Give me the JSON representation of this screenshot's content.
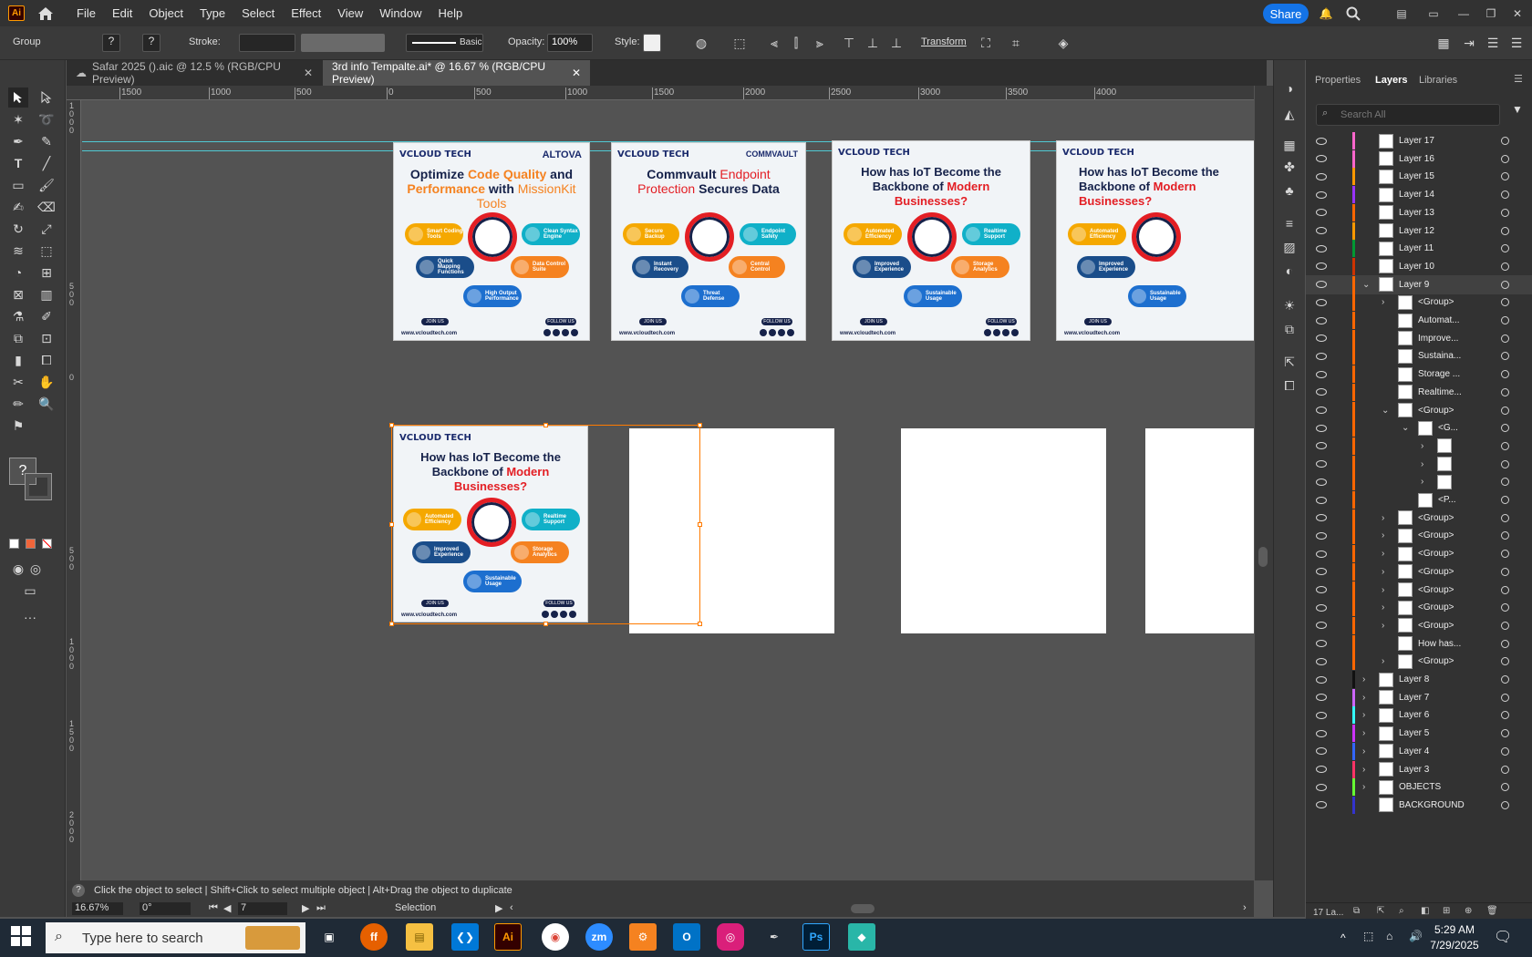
{
  "app": {
    "logo": "Ai"
  },
  "menu": [
    "File",
    "Edit",
    "Object",
    "Type",
    "Select",
    "Effect",
    "View",
    "Window",
    "Help"
  ],
  "header": {
    "share_label": "Share"
  },
  "control": {
    "selection_type": "Group",
    "stroke_label": "Stroke:",
    "stroke_style": "Basic",
    "opacity_label": "Opacity:",
    "opacity_value": "100%",
    "style_label": "Style:",
    "transform_label": "Transform",
    "q1": "?",
    "q2": "?"
  },
  "tabs": [
    {
      "label": "Safar 2025 ().aic @ 12.5 % (RGB/CPU Preview)"
    },
    {
      "label": "3rd info Tempalte.ai* @ 16.67 % (RGB/CPU Preview)"
    }
  ],
  "ruler": {
    "h": [
      "1500",
      "1000",
      "500",
      "0",
      "500",
      "1000",
      "1500",
      "2000",
      "2500",
      "3000",
      "3500",
      "4000"
    ],
    "v": [
      "1\n0\n0\n0",
      "5\n0\n0",
      "0",
      "5\n0\n0",
      "1\n0\n0\n0",
      "1\n5\n0\n0",
      "2\n0\n0\n0"
    ]
  },
  "artboards": {
    "a1": {
      "brand": "VCLOUD TECH",
      "partner": "ALTOVA",
      "headline_1": "Optimize ",
      "headline_2": "Code Quality",
      "headline_3": " and ",
      "headline_4": "Performance",
      "headline_5": " with ",
      "headline_6": "MissionKit Tools",
      "f1": "Smart Coding Tools",
      "f2": "Clean Syntax Engine",
      "f3": "Quick Mapping Functions",
      "f4": "Data Control Suite",
      "f5": "High Output Performance"
    },
    "a2": {
      "brand": "VCLOUD TECH",
      "partner": "COMMVAULT",
      "headline_1": "Commvault ",
      "headline_2": "Endpoint Protection",
      "headline_3": " Secures Data",
      "f1": "Secure Backup",
      "f2": "Endpoint Safety",
      "f3": "Instant Recovery",
      "f4": "Central Control",
      "f5": "Threat Defense"
    },
    "a3": {
      "brand": "VCLOUD TECH",
      "headline_1": "How has IoT Become the Backbone of ",
      "headline_2": "Modern Businesses?",
      "f1": "Automated Efficiency",
      "f2": "Realtime Support",
      "f3": "Improved Experience",
      "f4": "Storage Analytics",
      "f5": "Sustainable Usage"
    },
    "join": "JOIN US",
    "follow": "FOLLOW US",
    "site": "www.vcloudtech.com"
  },
  "hint": {
    "text": "Click the object to select  |  Shift+Click to select multiple object  |  Alt+Drag the object to duplicate"
  },
  "status": {
    "zoom": "16.67%",
    "rotation": "0°",
    "artboard": "7",
    "tool": "Selection"
  },
  "panel": {
    "tabs": [
      "Properties",
      "Layers",
      "Libraries"
    ],
    "search_placeholder": "Search All",
    "footer": "17 La..."
  },
  "layers": [
    {
      "name": "Layer 17",
      "color": "#ff66cc",
      "indent": 0,
      "chev": ""
    },
    {
      "name": "Layer 16",
      "color": "#ff66cc",
      "indent": 0,
      "chev": ""
    },
    {
      "name": "Layer 15",
      "color": "#ff9900",
      "indent": 0,
      "chev": ""
    },
    {
      "name": "Layer 14",
      "color": "#9933ff",
      "indent": 0,
      "chev": ""
    },
    {
      "name": "Layer 13",
      "color": "#ff6600",
      "indent": 0,
      "chev": ""
    },
    {
      "name": "Layer 12",
      "color": "#ff9900",
      "indent": 0,
      "chev": ""
    },
    {
      "name": "Layer 11",
      "color": "#009933",
      "indent": 0,
      "chev": ""
    },
    {
      "name": "Layer 10",
      "color": "#cc3300",
      "indent": 0,
      "chev": ""
    },
    {
      "name": "Layer 9",
      "color": "#ff6600",
      "indent": 0,
      "chev": "v",
      "sel": true
    },
    {
      "name": "<Group>",
      "color": "#ff6600",
      "indent": 1,
      "chev": ">"
    },
    {
      "name": "Automat...",
      "color": "#ff6600",
      "indent": 1,
      "chev": ""
    },
    {
      "name": "Improve...",
      "color": "#ff6600",
      "indent": 1,
      "chev": ""
    },
    {
      "name": "Sustaina...",
      "color": "#ff6600",
      "indent": 1,
      "chev": ""
    },
    {
      "name": "Storage ...",
      "color": "#ff6600",
      "indent": 1,
      "chev": ""
    },
    {
      "name": "Realtime...",
      "color": "#ff6600",
      "indent": 1,
      "chev": ""
    },
    {
      "name": "<Group>",
      "color": "#ff6600",
      "indent": 1,
      "chev": "v"
    },
    {
      "name": "<G...",
      "color": "#ff6600",
      "indent": 2,
      "chev": "v"
    },
    {
      "name": "",
      "color": "#ff6600",
      "indent": 3,
      "chev": ">"
    },
    {
      "name": "",
      "color": "#ff6600",
      "indent": 3,
      "chev": ">"
    },
    {
      "name": "",
      "color": "#ff6600",
      "indent": 3,
      "chev": ">"
    },
    {
      "name": "<P...",
      "color": "#ff6600",
      "indent": 2,
      "chev": ""
    },
    {
      "name": "<Group>",
      "color": "#ff6600",
      "indent": 1,
      "chev": ">"
    },
    {
      "name": "<Group>",
      "color": "#ff6600",
      "indent": 1,
      "chev": ">"
    },
    {
      "name": "<Group>",
      "color": "#ff6600",
      "indent": 1,
      "chev": ">"
    },
    {
      "name": "<Group>",
      "color": "#ff6600",
      "indent": 1,
      "chev": ">"
    },
    {
      "name": "<Group>",
      "color": "#ff6600",
      "indent": 1,
      "chev": ">"
    },
    {
      "name": "<Group>",
      "color": "#ff6600",
      "indent": 1,
      "chev": ">"
    },
    {
      "name": "<Group>",
      "color": "#ff6600",
      "indent": 1,
      "chev": ">"
    },
    {
      "name": "How has...",
      "color": "#ff6600",
      "indent": 1,
      "chev": ""
    },
    {
      "name": "<Group>",
      "color": "#ff6600",
      "indent": 1,
      "chev": ">"
    },
    {
      "name": "Layer 8",
      "color": "#111111",
      "indent": 0,
      "chev": ">"
    },
    {
      "name": "Layer 7",
      "color": "#cc66ff",
      "indent": 0,
      "chev": ">"
    },
    {
      "name": "Layer 6",
      "color": "#33ffff",
      "indent": 0,
      "chev": ">"
    },
    {
      "name": "Layer 5",
      "color": "#cc33ff",
      "indent": 0,
      "chev": ">"
    },
    {
      "name": "Layer 4",
      "color": "#3366ff",
      "indent": 0,
      "chev": ">"
    },
    {
      "name": "Layer 3",
      "color": "#ff3366",
      "indent": 0,
      "chev": ">"
    },
    {
      "name": "OBJECTS",
      "color": "#66ff33",
      "indent": 0,
      "chev": ">"
    },
    {
      "name": "BACKGROUND",
      "color": "#3333cc",
      "indent": 0,
      "chev": ""
    }
  ],
  "taskbar": {
    "search_placeholder": "Type here to search",
    "time": "5:29 AM",
    "date": "7/29/2025",
    "apps": [
      "Firefox",
      "Files",
      "VS Code",
      "Illustrator",
      "Chrome",
      "Zoom",
      "Tools",
      "Outlook",
      "Creative",
      "Pen",
      "Photoshop",
      "App"
    ]
  }
}
